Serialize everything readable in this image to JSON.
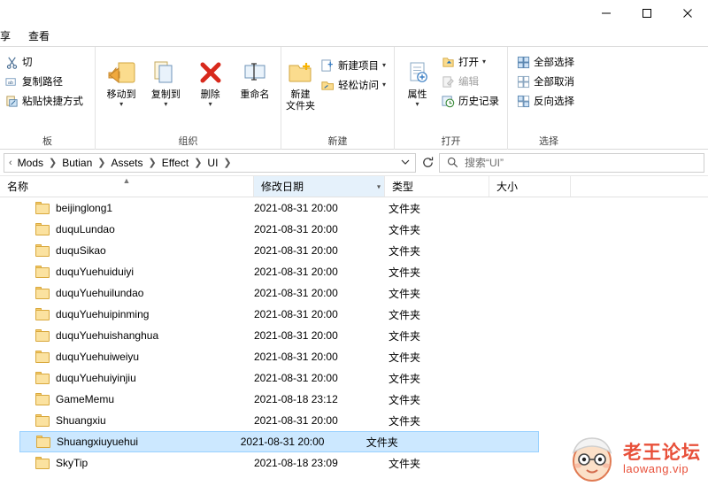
{
  "window": {
    "minimize_label": "─",
    "maximize_label": "□",
    "close_label": "✕"
  },
  "tabs": [
    {
      "label": "享",
      "name": "tab-share"
    },
    {
      "label": "查看",
      "name": "tab-view"
    }
  ],
  "ribbon": {
    "groups": [
      {
        "name": "clipboard",
        "label": "板",
        "items": [
          {
            "label": "切",
            "name": "cut-button",
            "icon": "scissors-icon"
          },
          {
            "label": "复制路径",
            "name": "copy-path-button",
            "icon": "copy-path-icon"
          },
          {
            "label": "粘贴快捷方式",
            "name": "paste-shortcut-button",
            "icon": "paste-shortcut-icon"
          }
        ]
      },
      {
        "name": "organize",
        "label": "组织",
        "items": [
          {
            "label": "移动到",
            "name": "move-to-button",
            "icon": "move-to-icon",
            "caret": true
          },
          {
            "label": "复制到",
            "name": "copy-to-button",
            "icon": "copy-to-icon",
            "caret": true
          },
          {
            "label": "删除",
            "name": "delete-button",
            "icon": "delete-x-icon",
            "caret": true
          },
          {
            "label": "重命名",
            "name": "rename-button",
            "icon": "rename-icon"
          }
        ]
      },
      {
        "name": "new",
        "label": "新建",
        "items": [
          {
            "label": "新建\n文件夹",
            "label_line1": "新建",
            "label_line2": "文件夹",
            "name": "new-folder-button",
            "icon": "new-folder-icon"
          },
          {
            "label": "新建项目",
            "name": "new-item-button",
            "icon": "new-item-icon",
            "caret": true
          },
          {
            "label": "轻松访问",
            "name": "easy-access-button",
            "icon": "easy-access-icon",
            "caret": true
          }
        ]
      },
      {
        "name": "open",
        "label": "打开",
        "items": [
          {
            "label": "属性",
            "name": "properties-button",
            "icon": "properties-icon",
            "caret": true
          },
          {
            "label": "打开",
            "name": "open-button",
            "icon": "open-icon",
            "caret": true
          },
          {
            "label": "编辑",
            "name": "edit-button",
            "icon": "edit-icon",
            "disabled": true
          },
          {
            "label": "历史记录",
            "name": "history-button",
            "icon": "history-icon"
          }
        ]
      },
      {
        "name": "select",
        "label": "选择",
        "items": [
          {
            "label": "全部选择",
            "name": "select-all-button",
            "icon": "select-all-icon"
          },
          {
            "label": "全部取消",
            "name": "select-none-button",
            "icon": "select-none-icon"
          },
          {
            "label": "反向选择",
            "name": "invert-selection-button",
            "icon": "invert-selection-icon"
          }
        ]
      }
    ]
  },
  "address": {
    "leading": "‹",
    "crumbs": [
      "Mods",
      "Butian",
      "Assets",
      "Effect",
      "UI"
    ],
    "separator": "❯",
    "dropdown_glyph": "⌄",
    "refresh_glyph": "↻",
    "search_placeholder": "搜索“UI”",
    "search_value": ""
  },
  "columns": [
    {
      "label": "名称",
      "name": "column-name",
      "sorted": true
    },
    {
      "label": "修改日期",
      "name": "column-date-modified",
      "sorted": false,
      "active": true
    },
    {
      "label": "类型",
      "name": "column-type",
      "sorted": false
    },
    {
      "label": "大小",
      "name": "column-size",
      "sorted": false
    }
  ],
  "files": [
    {
      "name": "beijinglong1",
      "date": "2021-08-31 20:00",
      "type": "文件夹",
      "size": "",
      "selected": false
    },
    {
      "name": "duquLundao",
      "date": "2021-08-31 20:00",
      "type": "文件夹",
      "size": "",
      "selected": false
    },
    {
      "name": "duquSikao",
      "date": "2021-08-31 20:00",
      "type": "文件夹",
      "size": "",
      "selected": false
    },
    {
      "name": "duquYuehuiduiyi",
      "date": "2021-08-31 20:00",
      "type": "文件夹",
      "size": "",
      "selected": false
    },
    {
      "name": "duquYuehuilundao",
      "date": "2021-08-31 20:00",
      "type": "文件夹",
      "size": "",
      "selected": false
    },
    {
      "name": "duquYuehuipinming",
      "date": "2021-08-31 20:00",
      "type": "文件夹",
      "size": "",
      "selected": false
    },
    {
      "name": "duquYuehuishanghua",
      "date": "2021-08-31 20:00",
      "type": "文件夹",
      "size": "",
      "selected": false
    },
    {
      "name": "duquYuehuiweiyu",
      "date": "2021-08-31 20:00",
      "type": "文件夹",
      "size": "",
      "selected": false
    },
    {
      "name": "duquYuehuiyinjiu",
      "date": "2021-08-31 20:00",
      "type": "文件夹",
      "size": "",
      "selected": false
    },
    {
      "name": "GameMemu",
      "date": "2021-08-18 23:12",
      "type": "文件夹",
      "size": "",
      "selected": false
    },
    {
      "name": "Shuangxiu",
      "date": "2021-08-31 20:00",
      "type": "文件夹",
      "size": "",
      "selected": false
    },
    {
      "name": "Shuangxiuyuehui",
      "date": "2021-08-31 20:00",
      "type": "文件夹",
      "size": "",
      "selected": true
    },
    {
      "name": "SkyTip",
      "date": "2021-08-18 23:09",
      "type": "文件夹",
      "size": "",
      "selected": false
    }
  ],
  "watermark": {
    "title": "老王论坛",
    "url": "laowang.vip",
    "color": "#e8503a"
  }
}
